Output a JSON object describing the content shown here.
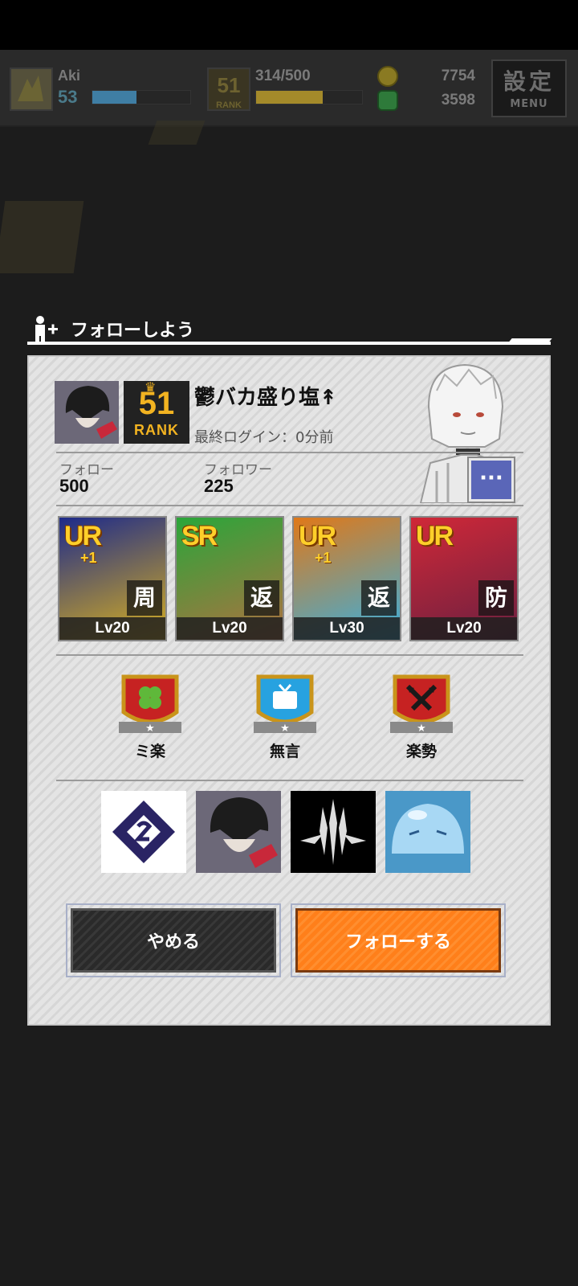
{
  "topbar": {
    "player_name": "Aki",
    "player_level": "53",
    "level_progress": 0.45,
    "rank_number": "51",
    "rank_label": "RANK",
    "stamina": "314/500",
    "stamina_progress": 0.63,
    "coins": "7754",
    "gems": "3598",
    "menu_big": "設定",
    "menu_small": "MENU"
  },
  "dialog": {
    "title": "フォローしよう",
    "profile": {
      "name": "鬱バカ盛り塩↟",
      "rank_number": "51",
      "rank_label": "RANK",
      "last_login": "最終ログイン：0分前",
      "follow_label": "フォロー",
      "follow_count": "500",
      "follower_label": "フォロワー",
      "follower_count": "225",
      "more_icon": "ellipsis-icon"
    },
    "cards": [
      {
        "rarity": "UR",
        "plus": "+1",
        "type": "周",
        "level": "Lv20",
        "colors": [
          "#1d2a8a",
          "#d8b020"
        ]
      },
      {
        "rarity": "SR",
        "plus": "",
        "type": "返",
        "level": "Lv20",
        "colors": [
          "#2aa63a",
          "#b07040"
        ]
      },
      {
        "rarity": "UR",
        "plus": "+1",
        "type": "返",
        "level": "Lv30",
        "colors": [
          "#e07818",
          "#38b0e0"
        ]
      },
      {
        "rarity": "UR",
        "plus": "",
        "type": "防",
        "level": "Lv20",
        "colors": [
          "#d02838",
          "#6a2040"
        ]
      }
    ],
    "badges": [
      {
        "label": "ミ楽",
        "icon": "clover-icon"
      },
      {
        "label": "無言",
        "icon": "tv-icon"
      },
      {
        "label": "楽勢",
        "icon": "crossed-swords-icon"
      }
    ],
    "favorites": [
      {
        "icon": "diamond-logo-icon"
      },
      {
        "icon": "character-avatar-icon"
      },
      {
        "icon": "emblem-icon"
      },
      {
        "icon": "slime-icon"
      }
    ],
    "cancel_label": "やめる",
    "follow_label": "フォローする"
  }
}
